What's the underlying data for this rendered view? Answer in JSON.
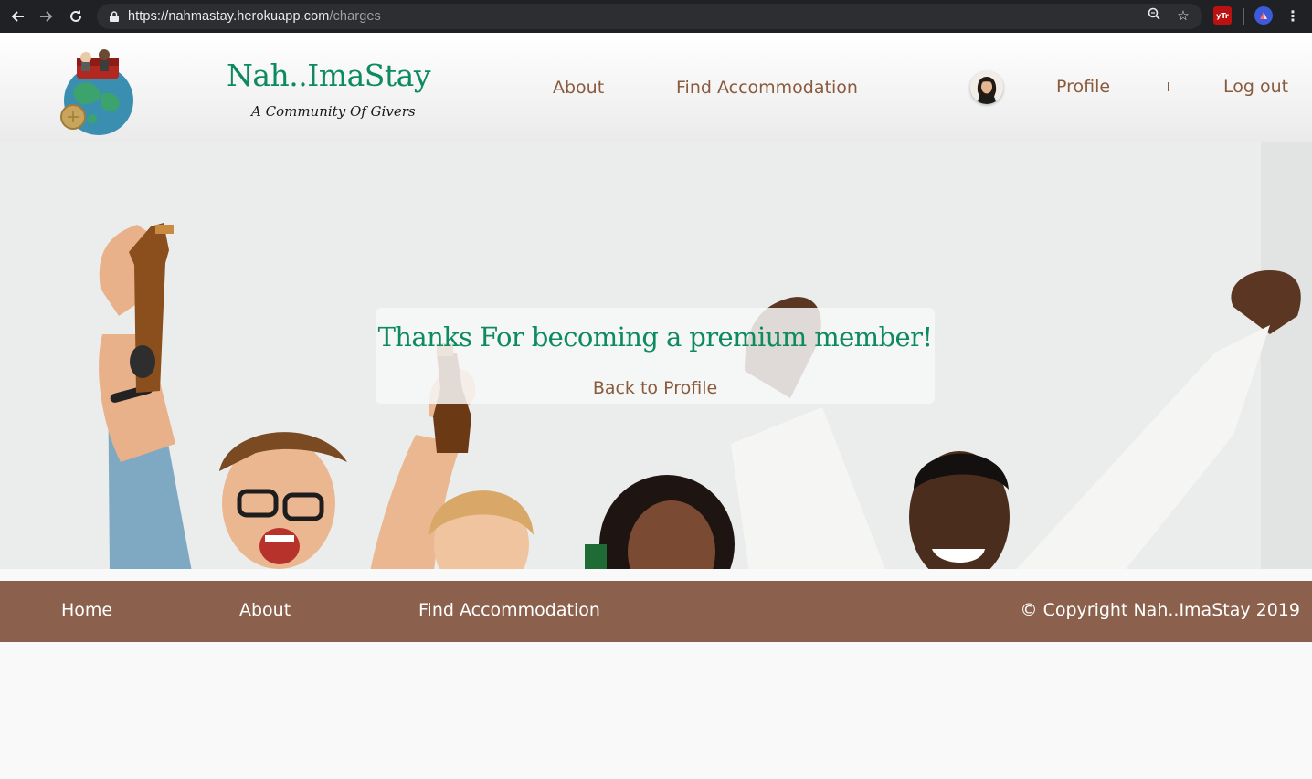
{
  "browser": {
    "url_host": "https://nahmastay.herokuapp.com",
    "url_path": "/charges",
    "ext_label": "yTr"
  },
  "header": {
    "brand": "Nah..ImaStay",
    "tagline": "A Community Of Givers",
    "nav": {
      "about": "About",
      "find": "Find Accommodation",
      "profile": "Profile",
      "logout": "Log out"
    }
  },
  "main": {
    "message": "Thanks For becoming a premium member!",
    "back_link": "Back to Profile"
  },
  "footer": {
    "home": "Home",
    "about": "About",
    "find": "Find Accommodation",
    "copyright": "© Copyright Nah..ImaStay 2019"
  },
  "colors": {
    "brand_green": "#0d8a5f",
    "link_brown": "#8a5a3d",
    "footer_bg": "#8b604c",
    "chrome_bg": "#202124"
  }
}
